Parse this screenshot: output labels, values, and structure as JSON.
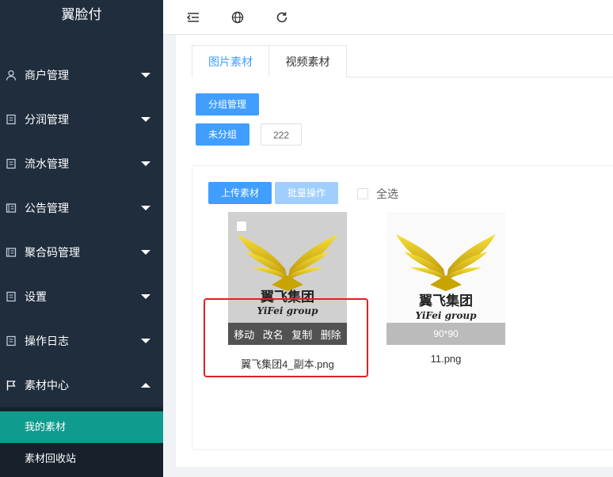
{
  "sidebar": {
    "brand": "翼脸付",
    "items": [
      {
        "label": "商户管理",
        "icon": "user-icon"
      },
      {
        "label": "分润管理",
        "icon": "document-icon"
      },
      {
        "label": "流水管理",
        "icon": "document-icon"
      },
      {
        "label": "公告管理",
        "icon": "notice-icon"
      },
      {
        "label": "聚合码管理",
        "icon": "notice-icon"
      },
      {
        "label": "设置",
        "icon": "document-icon"
      },
      {
        "label": "操作日志",
        "icon": "document-icon"
      },
      {
        "label": "素材中心",
        "icon": "flag-icon"
      }
    ],
    "submenu": [
      "我的素材",
      "素材回收站"
    ]
  },
  "tabs": [
    "图片素材",
    "视频素材"
  ],
  "toolbar": {
    "group_manage": "分组管理",
    "ungrouped": "未分组",
    "group_222": "222"
  },
  "media": {
    "upload": "上传素材",
    "batch": "批量操作",
    "select_all": "全选"
  },
  "cards": [
    {
      "name": "翼飞集团4_副本.png",
      "actions": [
        "移动",
        "改名",
        "复制",
        "删除"
      ],
      "logo_cn": "翼飞集团",
      "logo_en": "YiFei group"
    },
    {
      "name": "11.png",
      "size": "90*90",
      "logo_cn": "翼飞集团",
      "logo_en": "YiFei group"
    }
  ],
  "colors": {
    "sidebar_bg": "#1f2d3d",
    "active_sub": "#0f9b8e",
    "primary": "#409eff",
    "highlight": "#e02020"
  }
}
